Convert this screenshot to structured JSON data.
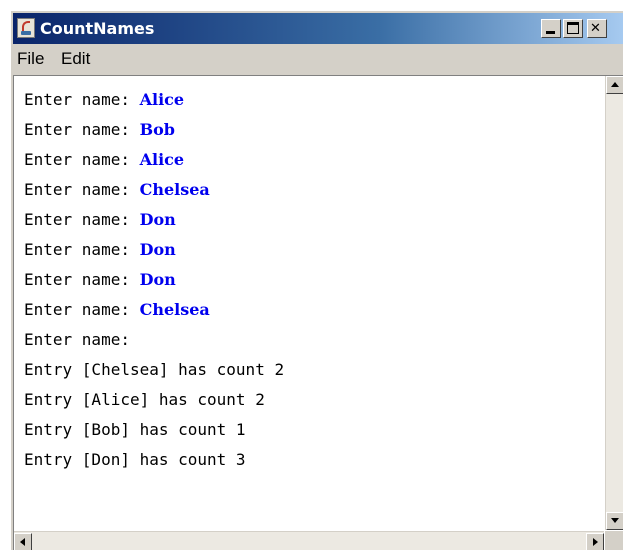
{
  "window": {
    "title": "CountNames",
    "title_icon": "java-icon",
    "controls": [
      "minimize",
      "maximize",
      "close"
    ]
  },
  "menubar": {
    "items": [
      "File",
      "Edit"
    ]
  },
  "console": {
    "lines": [
      {
        "prompt": "Enter name: ",
        "input": "Alice"
      },
      {
        "prompt": "Enter name: ",
        "input": "Bob"
      },
      {
        "prompt": "Enter name: ",
        "input": "Alice"
      },
      {
        "prompt": "Enter name: ",
        "input": "Chelsea"
      },
      {
        "prompt": "Enter name: ",
        "input": "Don"
      },
      {
        "prompt": "Enter name: ",
        "input": "Don"
      },
      {
        "prompt": "Enter name: ",
        "input": "Don"
      },
      {
        "prompt": "Enter name: ",
        "input": "Chelsea"
      },
      {
        "prompt": "Enter name: ",
        "input": ""
      },
      {
        "prompt": "Entry [Chelsea] has count 2",
        "input": ""
      },
      {
        "prompt": "Entry [Alice] has count 2",
        "input": ""
      },
      {
        "prompt": "Entry [Bob] has count 1",
        "input": ""
      },
      {
        "prompt": "Entry [Don] has count 3",
        "input": ""
      }
    ]
  },
  "colors": {
    "titlebar_start": "#0a246a",
    "titlebar_end": "#a6caf0",
    "input_text": "#0000ee",
    "chrome": "#d4d0c8"
  }
}
